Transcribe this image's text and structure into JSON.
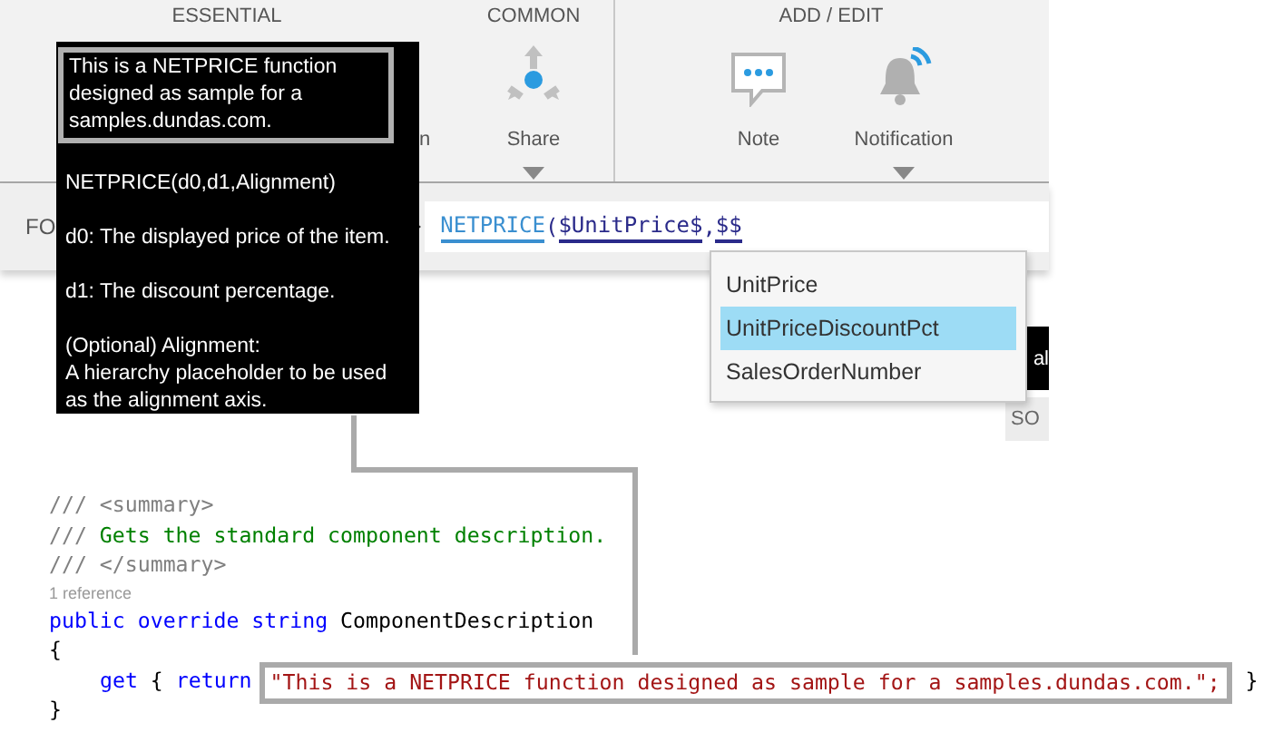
{
  "ribbon": {
    "groups": [
      {
        "title": "ESSENTIAL",
        "items": [
          {
            "label": "n",
            "has_menu": false
          }
        ]
      },
      {
        "title": "COMMON",
        "items": [
          {
            "label": "Share",
            "has_menu": true
          }
        ]
      },
      {
        "title": "ADD / EDIT",
        "items": [
          {
            "label": "Note",
            "has_menu": false
          },
          {
            "label": "Notification",
            "has_menu": true
          }
        ]
      }
    ]
  },
  "formula_bar": {
    "label": "FO",
    "tokens": [
      {
        "text": "NETPRICE",
        "kind": "function"
      },
      {
        "text": "(",
        "kind": "punct"
      },
      {
        "text": "$UnitPrice$",
        "kind": "field"
      },
      {
        "text": ",",
        "kind": "punct"
      },
      {
        "text": "$$",
        "kind": "field"
      }
    ]
  },
  "tooltip": {
    "description": "This is a NETPRICE function designed as sample for a samples.dundas.com.",
    "paragraphs": [
      "NETPRICE(d0,d1,Alignment)",
      "d0: The displayed price of the item.",
      "d1: The discount percentage.",
      "(Optional) Alignment:\nA hierarchy placeholder to be used as the alignment axis."
    ]
  },
  "suggestions": [
    {
      "label": "UnitPrice",
      "selected": false
    },
    {
      "label": "UnitPriceDiscountPct",
      "selected": true
    },
    {
      "label": "SalesOrderNumber",
      "selected": false
    }
  ],
  "background_cells": [
    {
      "text": "al",
      "kind": "dark"
    },
    {
      "text": "SO",
      "kind": "light"
    }
  ],
  "code": [
    {
      "kind": "code",
      "tokens": [
        {
          "text": "/// <summary>",
          "kind": "doc"
        }
      ]
    },
    {
      "kind": "code",
      "tokens": [
        {
          "text": "/// ",
          "kind": "doc"
        },
        {
          "text": "Gets the standard component description.",
          "kind": "comment"
        }
      ]
    },
    {
      "kind": "code",
      "tokens": [
        {
          "text": "/// </summary>",
          "kind": "doc"
        }
      ]
    },
    {
      "kind": "codelens",
      "tokens": [
        {
          "text": "1 reference",
          "kind": "lens"
        }
      ]
    },
    {
      "kind": "code",
      "tokens": [
        {
          "text": "public override string",
          "kind": "keyword"
        },
        {
          "text": " ComponentDescription",
          "kind": "plain"
        }
      ]
    },
    {
      "kind": "code",
      "tokens": [
        {
          "text": "{",
          "kind": "plain"
        }
      ]
    },
    {
      "kind": "indented",
      "tokens": [
        {
          "text": "get",
          "kind": "keyword"
        },
        {
          "text": " { ",
          "kind": "plain"
        },
        {
          "text": "return",
          "kind": "keyword"
        },
        {
          "text": "\"This is a NETPRICE function designed as sample for a samples.dundas.com.\";",
          "kind": "highlighted-string"
        },
        {
          "text": " }",
          "kind": "plain"
        }
      ]
    },
    {
      "kind": "code",
      "tokens": [
        {
          "text": "}",
          "kind": "plain"
        }
      ]
    }
  ]
}
